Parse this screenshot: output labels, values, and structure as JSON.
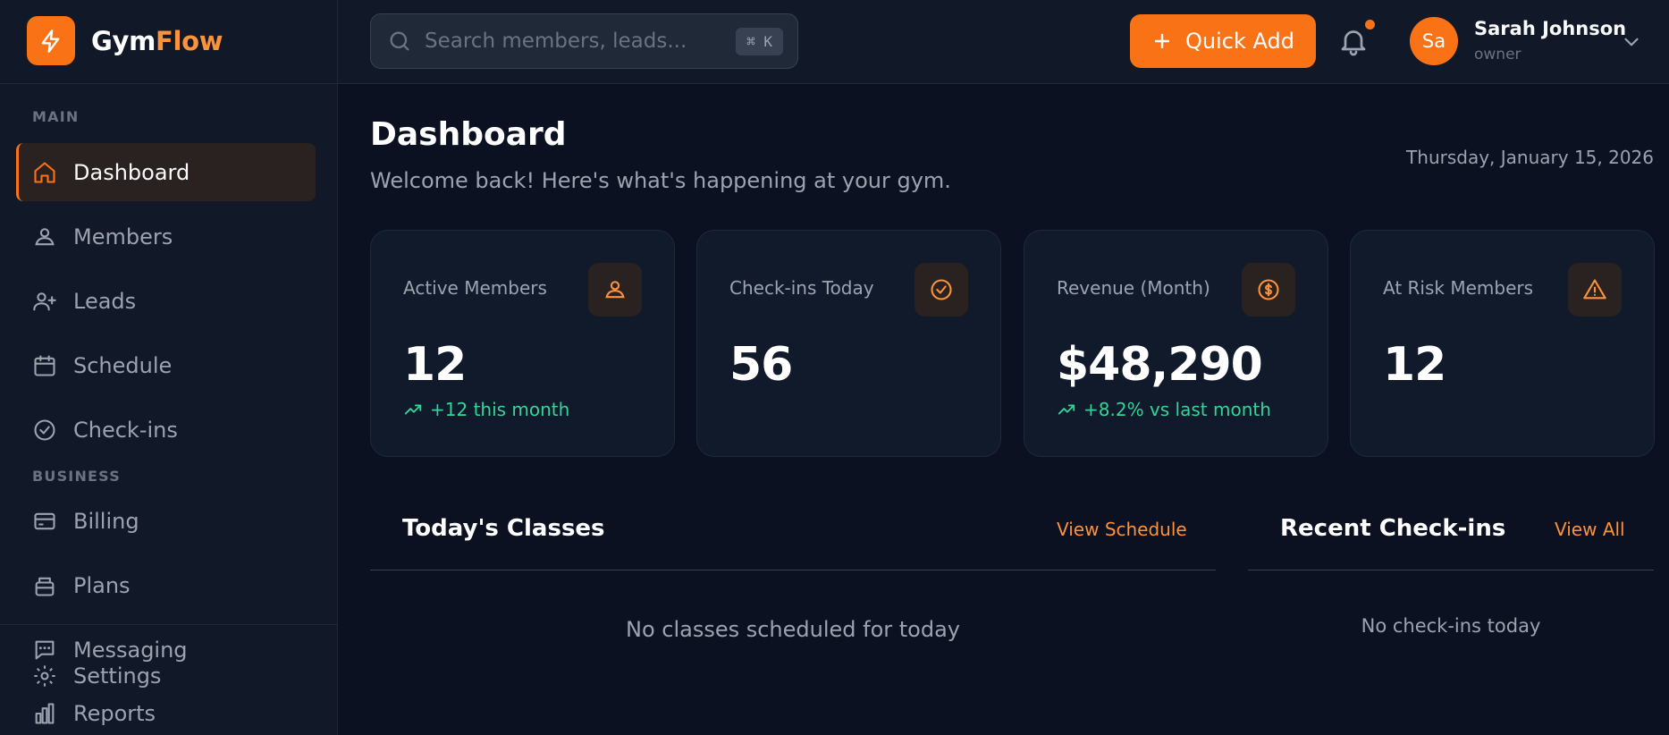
{
  "brand": {
    "name_part1": "Gym",
    "name_part2": "Flow",
    "logo_icon": "lightning-icon"
  },
  "sidebar": {
    "sections": [
      {
        "label": "MAIN"
      },
      {
        "label": "BUSINESS"
      }
    ],
    "items": [
      {
        "label": "Dashboard",
        "icon": "home-icon",
        "active": true
      },
      {
        "label": "Members",
        "icon": "members-icon"
      },
      {
        "label": "Leads",
        "icon": "user-plus-icon"
      },
      {
        "label": "Schedule",
        "icon": "calendar-icon"
      },
      {
        "label": "Check-ins",
        "icon": "check-circle-icon"
      },
      {
        "label": "Billing",
        "icon": "credit-card-icon"
      },
      {
        "label": "Plans",
        "icon": "package-icon"
      },
      {
        "label": "Messaging",
        "icon": "message-icon"
      },
      {
        "label": "Settings",
        "icon": "gear-icon"
      },
      {
        "label": "Reports",
        "icon": "bar-chart-icon"
      }
    ]
  },
  "header": {
    "search_placeholder": "Search members, leads...",
    "search_shortcut": "⌘ K",
    "quick_add_label": "Quick Add",
    "user": {
      "initials": "Sa",
      "name": "Sarah Johnson",
      "role": "owner"
    }
  },
  "page": {
    "title": "Dashboard",
    "subtitle": "Welcome back! Here's what's happening at your gym.",
    "date": "Thursday, January 15, 2026"
  },
  "stats": [
    {
      "label": "Active Members",
      "value": "12",
      "trend": "+12 this month",
      "icon": "members-icon"
    },
    {
      "label": "Check-ins Today",
      "value": "56",
      "trend": "",
      "icon": "check-circle-icon"
    },
    {
      "label": "Revenue (Month)",
      "value": "$48,290",
      "trend": "+8.2% vs last month",
      "icon": "dollar-icon"
    },
    {
      "label": "At Risk Members",
      "value": "12",
      "trend": "",
      "icon": "alert-triangle-icon"
    }
  ],
  "classes_panel": {
    "title": "Today's Classes",
    "link": "View Schedule",
    "empty": "No classes scheduled for today"
  },
  "checkins_panel": {
    "title": "Recent Check-ins",
    "link": "View All",
    "empty": "No check-ins today"
  },
  "colors": {
    "accent": "#f97316",
    "positive": "#34d399",
    "background": "#0b1120"
  }
}
